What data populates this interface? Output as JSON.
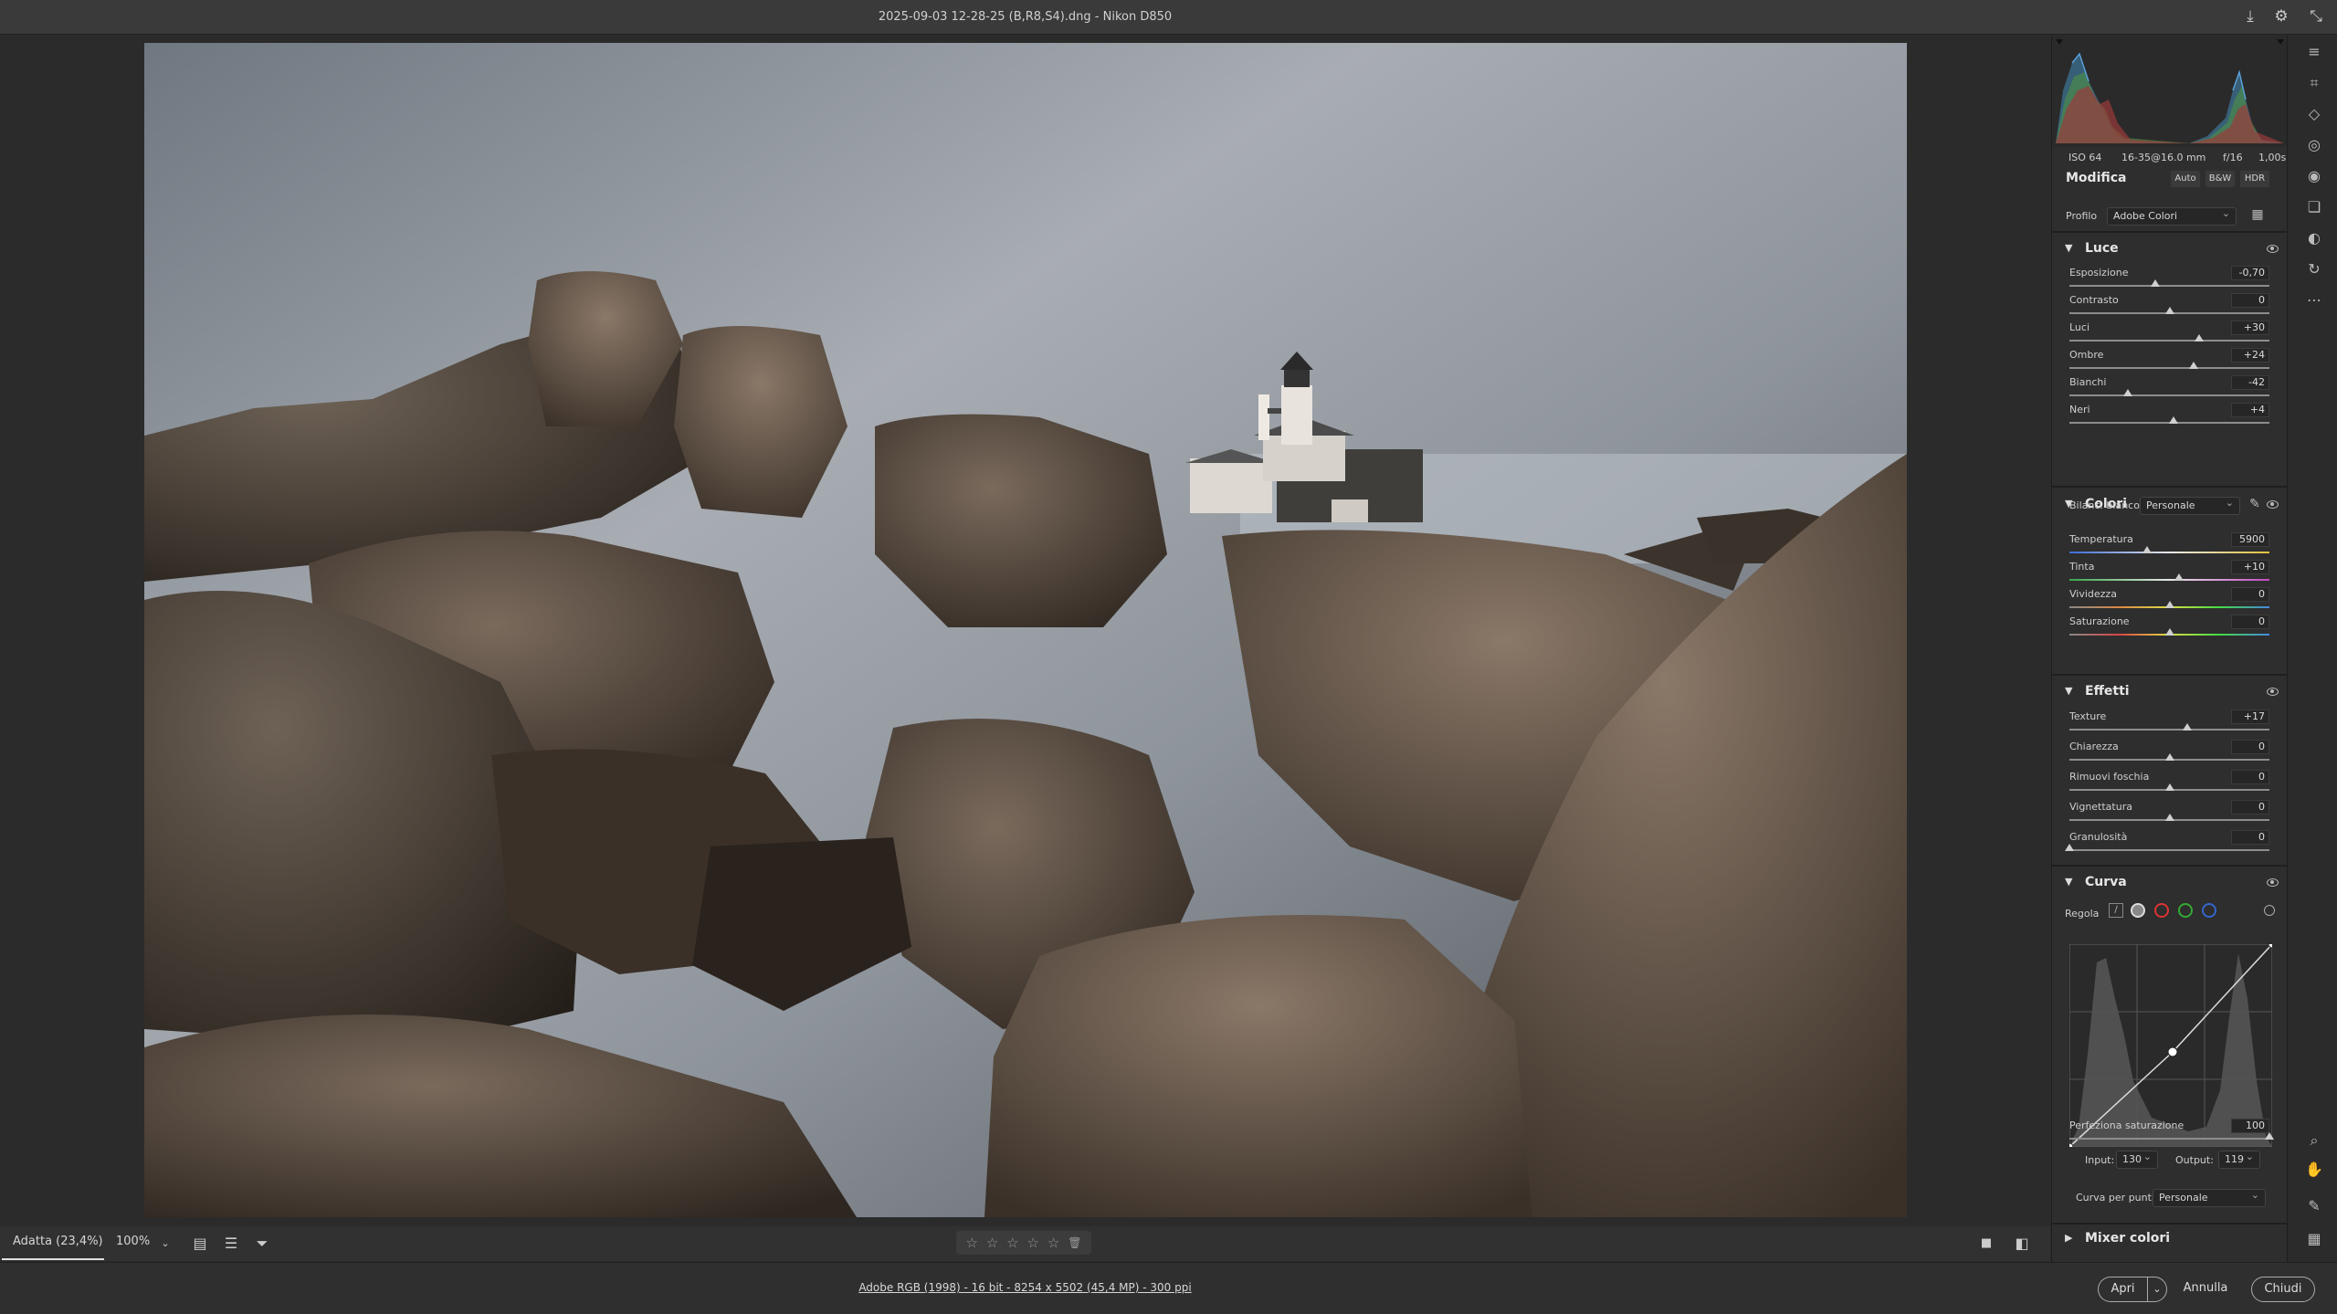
{
  "window": {
    "title": "2025-09-03 12-28-25 (B,R8,S4).dng  -  Nikon D850"
  },
  "photo": {
    "description_alt": "Immagine"
  },
  "exif": {
    "iso": "ISO 64",
    "lens": "16-35@16.0 mm",
    "aperture": "f/16",
    "shutter": "1,00s"
  },
  "edit": {
    "header": "Modifica",
    "buttons": [
      "Auto",
      "B&W",
      "HDR"
    ],
    "profile_label": "Profilo",
    "profile_value": "Adobe Colori"
  },
  "luce": {
    "title": "Luce",
    "sliders": [
      {
        "label": "Esposizione",
        "value": "-0,70",
        "pos": 0.43
      },
      {
        "label": "Contrasto",
        "value": "0",
        "pos": 0.5
      },
      {
        "label": "Luci",
        "value": "+30",
        "pos": 0.65
      },
      {
        "label": "Ombre",
        "value": "+24",
        "pos": 0.62
      },
      {
        "label": "Bianchi",
        "value": "-42",
        "pos": 0.29
      },
      {
        "label": "Neri",
        "value": "+4",
        "pos": 0.52
      }
    ]
  },
  "colori": {
    "title": "Colori",
    "wb_label": "Bilanc. bianco",
    "wb_value": "Personale",
    "sliders": [
      {
        "label": "Temperatura",
        "value": "5900",
        "pos": 0.39
      },
      {
        "label": "Tinta",
        "value": "+10",
        "pos": 0.55
      },
      {
        "label": "Vividezza",
        "value": "0",
        "pos": 0.5
      },
      {
        "label": "Saturazione",
        "value": "0",
        "pos": 0.5
      }
    ]
  },
  "effetti": {
    "title": "Effetti",
    "sliders": [
      {
        "label": "Texture",
        "value": "+17",
        "pos": 0.59
      },
      {
        "label": "Chiarezza",
        "value": "0",
        "pos": 0.5
      },
      {
        "label": "Rimuovi foschia",
        "value": "0",
        "pos": 0.5
      },
      {
        "label": "Vignettatura",
        "value": "0",
        "pos": 0.5
      },
      {
        "label": "Granulosità",
        "value": "0",
        "pos": 0.0
      }
    ]
  },
  "curva": {
    "title": "Curva",
    "regola_label": "Regola",
    "refine_label": "Perfeziona saturazione",
    "refine_value": "100",
    "input_label": "Input:",
    "input_value": "130",
    "output_label": "Output:",
    "output_value": "119",
    "points_label": "Curva per punti",
    "points_value": "Personale"
  },
  "mixer": {
    "title": "Mixer colori"
  },
  "filmbar": {
    "zoom_fit": "Adatta (23,4%)",
    "zoom_100": "100%"
  },
  "status": {
    "info": "Adobe RGB (1998) - 16 bit - 8254 x 5502 (45,4 MP) - 300 ppi"
  },
  "footer_buttons": {
    "open": "Apri",
    "cancel": "Annulla",
    "close": "Chiudi"
  },
  "colors": {
    "accent": "#d0d0d0",
    "panel": "#2e2e2e",
    "bg": "#2b2b2b"
  }
}
